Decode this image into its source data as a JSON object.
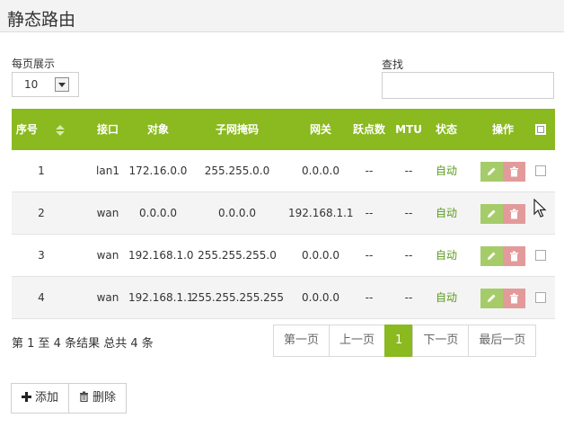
{
  "page": {
    "title": "静态路由"
  },
  "controls": {
    "per_page_label": "每页展示",
    "per_page_value": "10",
    "search_label": "查找",
    "search_value": ""
  },
  "table": {
    "headers": [
      "序号",
      "接口",
      "对象",
      "子网掩码",
      "网关",
      "跃点数",
      "MTU",
      "状态",
      "操作"
    ],
    "rows": [
      {
        "no": "1",
        "iface": "lan1",
        "target": "172.16.0.0",
        "mask": "255.255.0.0",
        "gateway": "0.0.0.0",
        "metric": "--",
        "mtu": "--",
        "status": "自动"
      },
      {
        "no": "2",
        "iface": "wan",
        "target": "0.0.0.0",
        "mask": "0.0.0.0",
        "gateway": "192.168.1.1",
        "metric": "--",
        "mtu": "--",
        "status": "自动"
      },
      {
        "no": "3",
        "iface": "wan",
        "target": "192.168.1.0",
        "mask": "255.255.255.0",
        "gateway": "0.0.0.0",
        "metric": "--",
        "mtu": "--",
        "status": "自动"
      },
      {
        "no": "4",
        "iface": "wan",
        "target": "192.168.1.1",
        "mask": "255.255.255.255",
        "gateway": "0.0.0.0",
        "metric": "--",
        "mtu": "--",
        "status": "自动"
      }
    ]
  },
  "summary": "第 1 至 4 条结果   总共 4 条",
  "pager": {
    "first": "第一页",
    "prev": "上一页",
    "current": "1",
    "next": "下一页",
    "last": "最后一页"
  },
  "actions": {
    "add": "添加",
    "delete": "删除"
  },
  "colors": {
    "accent": "#8ab920",
    "status_text": "#5a9a1e",
    "edit_btn": "#a6cc6a",
    "delete_btn": "#e39a9a"
  },
  "icons": {
    "sort": "sort-icon",
    "edit": "pencil-icon",
    "delete": "trash-icon",
    "add": "plus-icon"
  }
}
